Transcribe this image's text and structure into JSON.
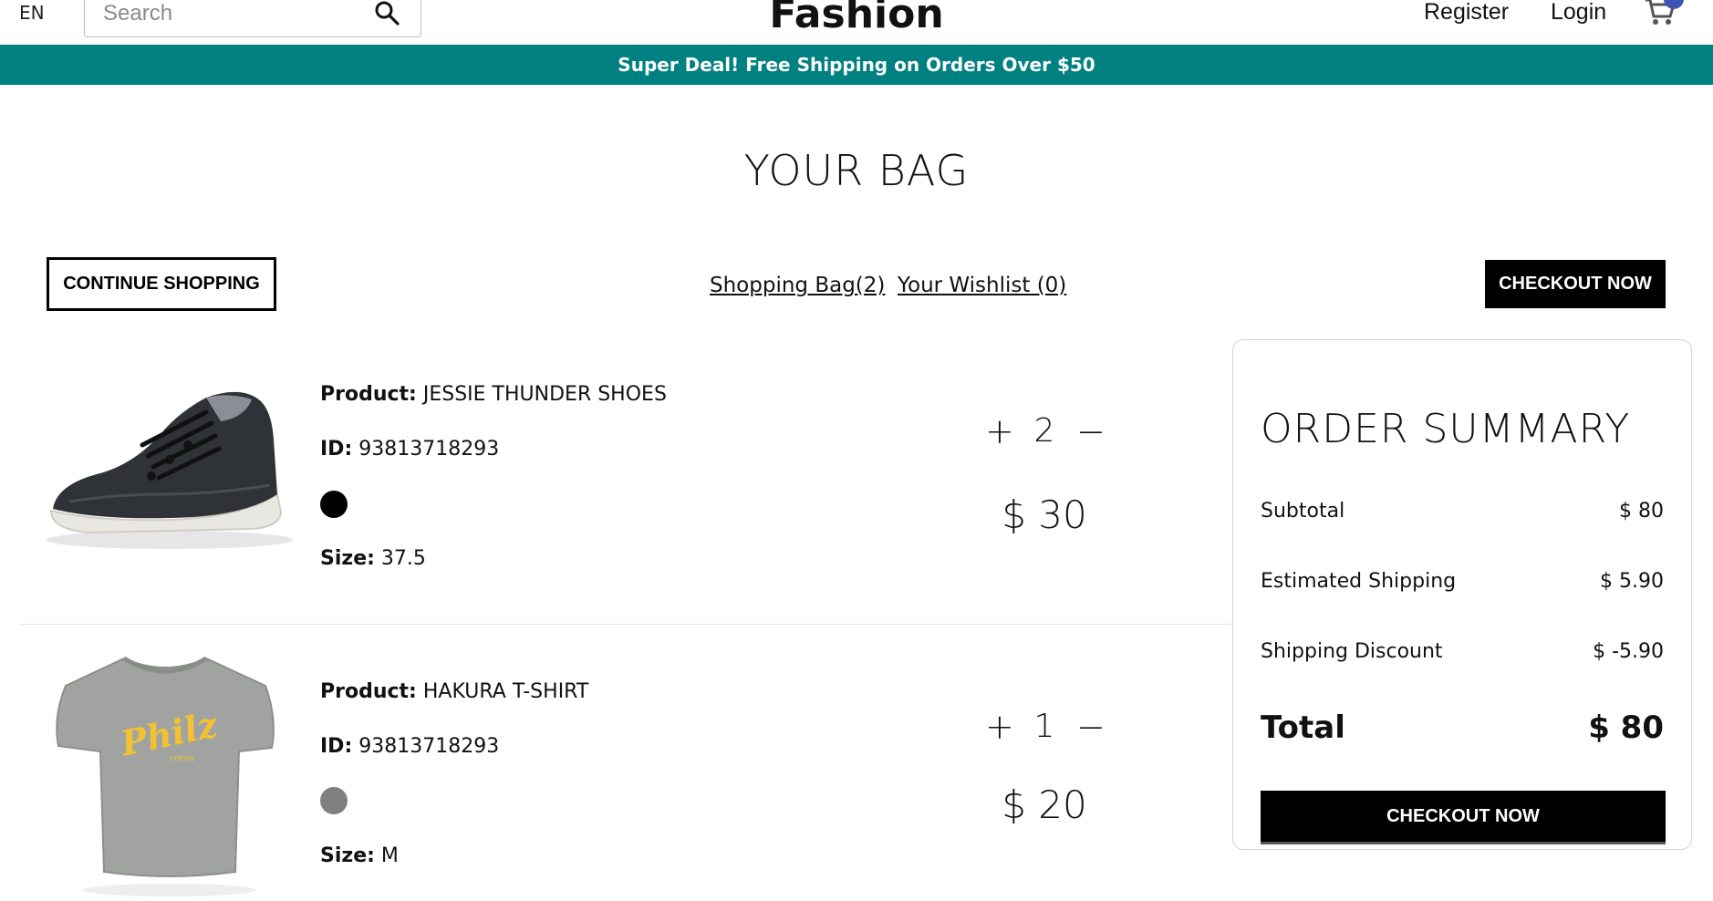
{
  "navbar": {
    "language": "EN",
    "search_placeholder": "Search",
    "logo": "Fashion",
    "register": "Register",
    "login": "Login"
  },
  "announcement": "Super Deal! Free Shipping on Orders Over $50",
  "page_title": "YOUR BAG",
  "top_bar": {
    "continue_label": "CONTINUE SHOPPING",
    "bag_link": "Shopping Bag(2)",
    "wishlist_link": "Your Wishlist (0)",
    "checkout_label": "CHECKOUT NOW"
  },
  "labels": {
    "product": "Product:",
    "id": "ID:",
    "size": "Size:"
  },
  "products": [
    {
      "name": "JESSIE THUNDER SHOES",
      "id": "93813718293",
      "color": "#000000",
      "size": "37.5",
      "quantity": "2",
      "price": "$ 30",
      "image": "sneaker-image"
    },
    {
      "name": "HAKURA T-SHIRT",
      "id": "93813718293",
      "color": "#808080",
      "size": "M",
      "quantity": "1",
      "price": "$ 20",
      "image": "tshirt-image",
      "print_text": "Philz",
      "print_subtext": "COFFEE"
    }
  ],
  "quantity_controls": {
    "increase": "+",
    "decrease": "−"
  },
  "summary": {
    "title": "ORDER SUMMARY",
    "subtotal_label": "Subtotal",
    "subtotal_value": "$ 80",
    "shipping_label": "Estimated Shipping",
    "shipping_value": "$ 5.90",
    "discount_label": "Shipping Discount",
    "discount_value": "$ -5.90",
    "total_label": "Total",
    "total_value": "$ 80",
    "checkout_label": "CHECKOUT NOW"
  },
  "colors": {
    "announcement_bg": "#008080",
    "cart_badge": "#3f51b5",
    "button_bg": "#000000"
  }
}
